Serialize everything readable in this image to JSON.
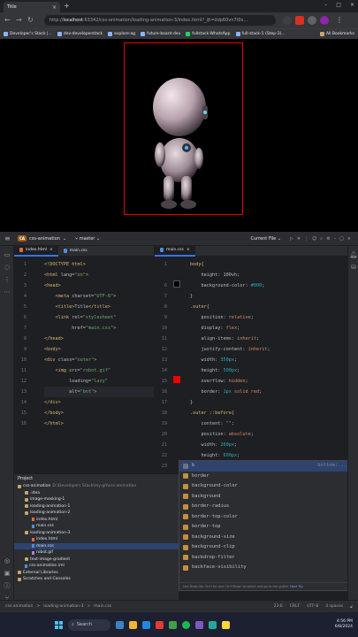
{
  "browser": {
    "tab_title": "Title",
    "tab_close": "×",
    "new_tab": "+",
    "window_controls": [
      "–",
      "□",
      "×"
    ],
    "url_prefix": "http://",
    "url_host": "localhost",
    "url_rest": ":63342/css-animation/loading-animation-3/index.html?_ijt=ddp60vn7t0s...",
    "bookmarks": [
      "Developer's Stack |...",
      "dev-developerstack",
      "explore-ag",
      "future-board-dev",
      "fullstack-WhatsApp",
      "full-stack-1 (Step-3)..."
    ],
    "all_bookmarks": "All Bookmarks"
  },
  "ide": {
    "project_badge": "CA",
    "project_name": "css-animation",
    "branch": "master",
    "current_file": "Current File",
    "left_tabs": [
      {
        "label": "index.html",
        "type": "html"
      },
      {
        "label": "main.css",
        "type": "css"
      }
    ],
    "right_tabs": [
      {
        "label": "main.css",
        "type": "css"
      }
    ]
  },
  "html_editor": {
    "line_numbers": [
      "1",
      "2",
      "3",
      "4",
      "5",
      "6",
      "7",
      "8",
      "9",
      "10",
      "11",
      "12",
      "13",
      "14",
      "15",
      "16"
    ],
    "lines": [
      [
        {
          "c": "tag",
          "t": "<!DOCTYPE html>"
        }
      ],
      [
        {
          "c": "tag",
          "t": "<html "
        },
        {
          "c": "attr",
          "t": "lang="
        },
        {
          "c": "str",
          "t": "\"en\""
        },
        {
          "c": "tag",
          "t": ">"
        }
      ],
      [
        {
          "c": "tag",
          "t": "<head>"
        }
      ],
      [
        {
          "c": "tag",
          "t": "    <meta "
        },
        {
          "c": "attr",
          "t": "charset="
        },
        {
          "c": "str",
          "t": "\"UTF-8\""
        },
        {
          "c": "tag",
          "t": ">"
        }
      ],
      [
        {
          "c": "tag",
          "t": "    <title>"
        },
        {
          "c": "txt",
          "t": "Title"
        },
        {
          "c": "tag",
          "t": "</title>"
        }
      ],
      [
        {
          "c": "tag",
          "t": "    <link "
        },
        {
          "c": "attr",
          "t": "rel="
        },
        {
          "c": "str",
          "t": "\"stylesheet\""
        }
      ],
      [
        {
          "c": "attr",
          "t": "          href="
        },
        {
          "c": "str",
          "t": "\"main.css\""
        },
        {
          "c": "tag",
          "t": ">"
        }
      ],
      [
        {
          "c": "tag",
          "t": "</head>"
        }
      ],
      [
        {
          "c": "tag",
          "t": "<body>"
        }
      ],
      [
        {
          "c": "tag",
          "t": "<div "
        },
        {
          "c": "attr",
          "t": "class="
        },
        {
          "c": "str",
          "t": "\"outer\""
        },
        {
          "c": "tag",
          "t": ">"
        }
      ],
      [
        {
          "c": "tag",
          "t": "    <img "
        },
        {
          "c": "attr",
          "t": "src="
        },
        {
          "c": "str",
          "t": "\"robot.gif\""
        }
      ],
      [
        {
          "c": "attr",
          "t": "         loading="
        },
        {
          "c": "str",
          "t": "\"lazy\""
        }
      ],
      [
        {
          "c": "attr",
          "t": "         alt="
        },
        {
          "c": "str",
          "t": "\"bot\""
        },
        {
          "c": "tag",
          "t": ">"
        }
      ],
      [
        {
          "c": "tag",
          "t": "</div>"
        }
      ],
      [
        {
          "c": "tag",
          "t": "</body>"
        }
      ],
      [
        {
          "c": "tag",
          "t": "</html>"
        }
      ]
    ]
  },
  "css_editor": {
    "line_numbers": [
      "1",
      "",
      "6",
      "7",
      "8",
      "9",
      "10",
      "11",
      "12",
      "13",
      "14",
      "15",
      "16",
      "17",
      "18",
      "19",
      "20",
      "21",
      "22",
      "23"
    ],
    "lines": [
      [
        {
          "c": "sel",
          "t": "body{"
        }
      ],
      [
        {
          "c": "prop",
          "t": "    height: 100vh;"
        }
      ],
      [
        {
          "c": "prop",
          "t": "    background-color: "
        },
        {
          "c": "num",
          "t": "#000"
        },
        {
          "c": "prop",
          "t": ";"
        }
      ],
      [
        {
          "c": "prop",
          "t": "}"
        }
      ],
      [
        {
          "c": "sel",
          "t": ".outer{"
        }
      ],
      [
        {
          "c": "prop",
          "t": "    position: "
        },
        {
          "c": "kw",
          "t": "relative"
        },
        {
          "c": "prop",
          "t": ";"
        }
      ],
      [
        {
          "c": "prop",
          "t": "    display: "
        },
        {
          "c": "kw",
          "t": "flex"
        },
        {
          "c": "prop",
          "t": ";"
        }
      ],
      [
        {
          "c": "prop",
          "t": "    align-items: "
        },
        {
          "c": "kw",
          "t": "inherit"
        },
        {
          "c": "prop",
          "t": ";"
        }
      ],
      [
        {
          "c": "prop",
          "t": "    justify-content: "
        },
        {
          "c": "kw",
          "t": "inherit"
        },
        {
          "c": "prop",
          "t": ";"
        }
      ],
      [
        {
          "c": "prop",
          "t": "    width: "
        },
        {
          "c": "num",
          "t": "350px"
        },
        {
          "c": "prop",
          "t": ";"
        }
      ],
      [
        {
          "c": "prop",
          "t": "    height: "
        },
        {
          "c": "num",
          "t": "500px"
        },
        {
          "c": "prop",
          "t": ";"
        }
      ],
      [
        {
          "c": "prop",
          "t": "    overflow: "
        },
        {
          "c": "kw",
          "t": "hidden"
        },
        {
          "c": "prop",
          "t": ";"
        }
      ],
      [
        {
          "c": "prop",
          "t": "    border: "
        },
        {
          "c": "num",
          "t": "1px"
        },
        {
          "c": "kw",
          "t": " solid red"
        },
        {
          "c": "prop",
          "t": ";"
        }
      ],
      [
        {
          "c": "prop",
          "t": "}"
        }
      ],
      [
        {
          "c": "sel",
          "t": ".outer ::before{"
        }
      ],
      [
        {
          "c": "prop",
          "t": "    content: "
        },
        {
          "c": "val",
          "t": "\"\""
        },
        {
          "c": "prop",
          "t": ";"
        }
      ],
      [
        {
          "c": "prop",
          "t": "    position: "
        },
        {
          "c": "kw",
          "t": "absolute"
        },
        {
          "c": "prop",
          "t": ";"
        }
      ],
      [
        {
          "c": "prop",
          "t": "    width: "
        },
        {
          "c": "num",
          "t": "260px"
        },
        {
          "c": "prop",
          "t": ";"
        }
      ],
      [
        {
          "c": "prop",
          "t": "    height: "
        },
        {
          "c": "num",
          "t": "600px"
        },
        {
          "c": "prop",
          "t": ";"
        }
      ],
      [
        {
          "c": "prop",
          "t": "    ba"
        }
      ]
    ]
  },
  "completion": {
    "suggestions": [
      "b",
      "border",
      "background-color",
      "background",
      "border-radius",
      "border-top-color",
      "border-top",
      "background-size",
      "background-clip",
      "backdrop-filter",
      "backface-visibility"
    ],
    "first_hint": "bottom:...;",
    "footer_prefix": "Use Down/Up Ctrl+Up and Ctrl+Down to select and go to the gutter.",
    "footer_link": "Next Tip"
  },
  "project_panel": {
    "title": "Project",
    "items": [
      {
        "label": "css-animation",
        "dim": " D:\\Developers Stack\\my-git\\css-animation",
        "kind": "fold",
        "indent": 0
      },
      {
        "label": ".idea",
        "kind": "fold",
        "indent": 1
      },
      {
        "label": "image-masking-1",
        "kind": "fold",
        "indent": 1
      },
      {
        "label": "loading-animation-1",
        "kind": "fold",
        "indent": 1
      },
      {
        "label": "loading-animation-2",
        "kind": "fold",
        "indent": 1
      },
      {
        "label": "index.html",
        "kind": "html",
        "indent": 2
      },
      {
        "label": "main.css",
        "kind": "css",
        "indent": 2
      },
      {
        "label": "loading-animation-3",
        "kind": "fold",
        "indent": 1
      },
      {
        "label": "index.html",
        "kind": "html",
        "indent": 2
      },
      {
        "label": "main.css",
        "kind": "css",
        "indent": 2
      },
      {
        "label": "robot.gif",
        "kind": "gif",
        "indent": 2
      },
      {
        "label": "text-image-gradient",
        "kind": "fold",
        "indent": 1
      },
      {
        "label": "css-animation.iml",
        "kind": "css",
        "indent": 1
      },
      {
        "label": "External Libraries",
        "kind": "fold",
        "indent": 0
      },
      {
        "label": "Scratches and Consoles",
        "kind": "fold",
        "indent": 0
      }
    ]
  },
  "statusbar": {
    "crumbs": [
      "css-animation",
      ">",
      "loading-animation-3",
      ">",
      "main.css"
    ],
    "position": "23:6",
    "line_sep": "CRLF",
    "encoding": "UTF-8",
    "indent": "4 spaces"
  },
  "taskbar": {
    "search": "Search",
    "time": "4:56 PM",
    "date": "6/8/2024"
  }
}
